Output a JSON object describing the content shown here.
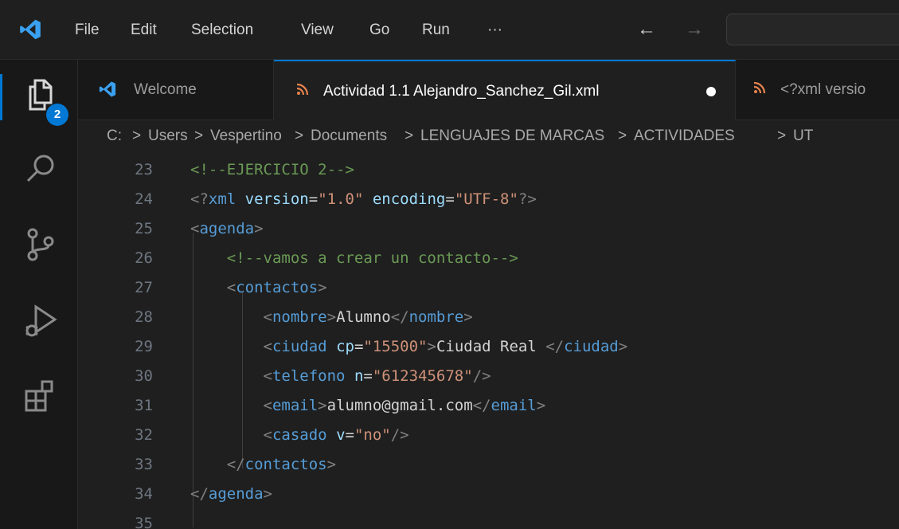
{
  "menu": {
    "file": "File",
    "edit": "Edit",
    "selection": "Selection",
    "view": "View",
    "go": "Go",
    "run": "Run",
    "more": "···"
  },
  "nav": {
    "back": "←",
    "forward": "→"
  },
  "activity_bar": {
    "explorer_badge": "2",
    "icons": [
      "explorer-icon",
      "search-icon",
      "source-control-icon",
      "run-debug-icon",
      "extensions-icon"
    ]
  },
  "tabs": [
    {
      "label": "Welcome",
      "icon": "vscode-logo-icon",
      "active": false
    },
    {
      "label": "Actividad 1.1 Alejandro_Sanchez_Gil.xml",
      "icon": "rss-icon",
      "active": true,
      "modified": true
    },
    {
      "label": "<?xml versio",
      "icon": "rss-icon",
      "active": false
    }
  ],
  "breadcrumb": {
    "items": [
      "C:",
      "Users",
      "Vespertino",
      "Documents",
      "LENGUAJES DE MARCAS",
      "ACTIVIDADES",
      "UT"
    ],
    "separator": ">"
  },
  "editor": {
    "lines": [
      {
        "number": "23",
        "tokens": [
          [
            "c",
            "<!--EJERCICIO 2-->"
          ]
        ]
      },
      {
        "number": "24",
        "tokens": [
          [
            "p",
            "<?"
          ],
          [
            "g",
            "xml"
          ],
          [
            "t",
            " "
          ],
          [
            "a",
            "version"
          ],
          [
            "t",
            "="
          ],
          [
            "s",
            "\"1.0\""
          ],
          [
            "t",
            " "
          ],
          [
            "a",
            "encoding"
          ],
          [
            "t",
            "="
          ],
          [
            "s",
            "\"UTF-8\""
          ],
          [
            "p",
            "?>"
          ]
        ]
      },
      {
        "number": "25",
        "tokens": [
          [
            "p",
            "<"
          ],
          [
            "g",
            "agenda"
          ],
          [
            "p",
            ">"
          ]
        ]
      },
      {
        "number": "26",
        "tokens": [
          [
            "t",
            "    "
          ],
          [
            "c",
            "<!--vamos a crear un contacto-->"
          ]
        ]
      },
      {
        "number": "27",
        "tokens": [
          [
            "t",
            "    "
          ],
          [
            "p",
            "<"
          ],
          [
            "g",
            "contactos"
          ],
          [
            "p",
            ">"
          ]
        ]
      },
      {
        "number": "28",
        "tokens": [
          [
            "t",
            "        "
          ],
          [
            "p",
            "<"
          ],
          [
            "g",
            "nombre"
          ],
          [
            "p",
            ">"
          ],
          [
            "t",
            "Alumno"
          ],
          [
            "p",
            "</"
          ],
          [
            "g",
            "nombre"
          ],
          [
            "p",
            ">"
          ]
        ]
      },
      {
        "number": "29",
        "tokens": [
          [
            "t",
            "        "
          ],
          [
            "p",
            "<"
          ],
          [
            "g",
            "ciudad"
          ],
          [
            "t",
            " "
          ],
          [
            "a",
            "cp"
          ],
          [
            "t",
            "="
          ],
          [
            "s",
            "\"15500\""
          ],
          [
            "p",
            ">"
          ],
          [
            "t",
            "Ciudad Real "
          ],
          [
            "p",
            "</"
          ],
          [
            "g",
            "ciudad"
          ],
          [
            "p",
            ">"
          ]
        ]
      },
      {
        "number": "30",
        "tokens": [
          [
            "t",
            "        "
          ],
          [
            "p",
            "<"
          ],
          [
            "g",
            "telefono"
          ],
          [
            "t",
            " "
          ],
          [
            "a",
            "n"
          ],
          [
            "t",
            "="
          ],
          [
            "s",
            "\"612345678\""
          ],
          [
            "p",
            "/>"
          ]
        ]
      },
      {
        "number": "31",
        "tokens": [
          [
            "t",
            "        "
          ],
          [
            "p",
            "<"
          ],
          [
            "g",
            "email"
          ],
          [
            "p",
            ">"
          ],
          [
            "t",
            "alumno@gmail.com"
          ],
          [
            "p",
            "</"
          ],
          [
            "g",
            "email"
          ],
          [
            "p",
            ">"
          ]
        ]
      },
      {
        "number": "32",
        "tokens": [
          [
            "t",
            "        "
          ],
          [
            "p",
            "<"
          ],
          [
            "g",
            "casado"
          ],
          [
            "t",
            " "
          ],
          [
            "a",
            "v"
          ],
          [
            "t",
            "="
          ],
          [
            "s",
            "\"no\""
          ],
          [
            "p",
            "/>"
          ]
        ]
      },
      {
        "number": "33",
        "tokens": [
          [
            "t",
            "    "
          ],
          [
            "p",
            "</"
          ],
          [
            "g",
            "contactos"
          ],
          [
            "p",
            ">"
          ]
        ]
      },
      {
        "number": "34",
        "tokens": [
          [
            "p",
            "</"
          ],
          [
            "g",
            "agenda"
          ],
          [
            "p",
            ">"
          ]
        ]
      },
      {
        "number": "35",
        "tokens": []
      }
    ]
  },
  "colors": {
    "accent": "#0078d4",
    "tag": "#569cd6",
    "attribute": "#9cdcfe",
    "string": "#ce9178",
    "comment": "#6a9955",
    "punctuation": "#808080",
    "text": "#d4d4d4",
    "rss": "#e8834e"
  }
}
